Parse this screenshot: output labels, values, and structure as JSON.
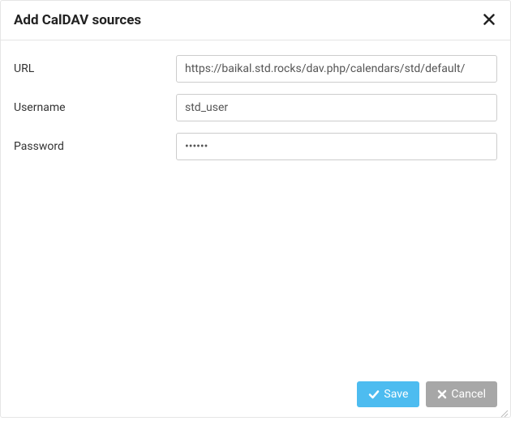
{
  "header": {
    "title": "Add CalDAV sources"
  },
  "form": {
    "url": {
      "label": "URL",
      "value": "https://baikal.std.rocks/dav.php/calendars/std/default/"
    },
    "username": {
      "label": "Username",
      "value": "std_user"
    },
    "password": {
      "label": "Password",
      "value": "••••••"
    }
  },
  "footer": {
    "save_label": "Save",
    "cancel_label": "Cancel"
  }
}
